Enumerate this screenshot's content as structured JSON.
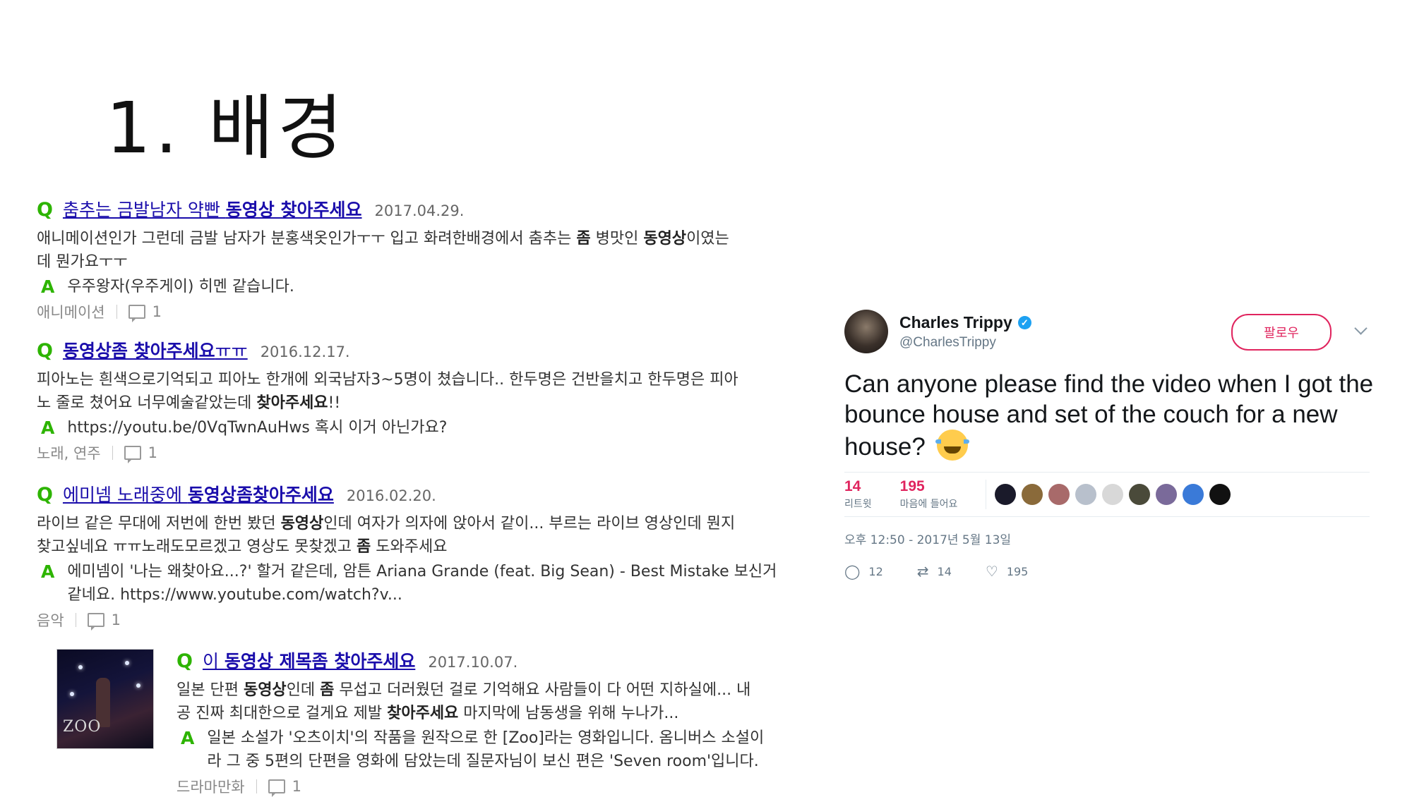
{
  "slide": {
    "title": "1. 배경"
  },
  "qa": [
    {
      "title_plain": "춤추는 금발남자 약빤 ",
      "title_bold": "동영상 찾아주세요",
      "date": "2017.04.29.",
      "body_parts": [
        "애니메이션인가 그런데 금발 남자가 분홍색옷인가ㅜㅜ 입고 화려한배경에서 춤추는 ",
        "좀",
        " 병맛인 ",
        "동영상",
        "이였는",
        "데 뭔가요ㅜㅜ"
      ],
      "answer": "우주왕자(우주게이) 히멘 같습니다.",
      "category": "애니메이션",
      "comments": "1"
    },
    {
      "title_bold": "동영상좀 찾아주세요",
      "title_plain": "ㅠㅠ",
      "date": "2016.12.17.",
      "body_line1": "피아노는 흰색으로기억되고 피아노 한개에 외국남자3~5명이 쳤습니다.. 한두명은 건반을치고 한두명은 피아",
      "body_line2_plain": "노 줄로 쳤어요 너무예술같았는데 ",
      "body_line2_bold": "찾아주세요",
      "body_line2_end": "!!",
      "answer": "https://youtu.be/0VqTwnAuHws 혹시 이거 아닌가요?",
      "category": "노래, 연주",
      "comments": "1"
    },
    {
      "title_plain": "에미넴 노래중에 ",
      "title_bold": "동영상좀찾아주세요",
      "date": "2016.02.20.",
      "body_line1_plain": "라이브 같은 무대에 저번에 한번 봤던 ",
      "body_line1_bold": "동영상",
      "body_line1_end": "인데 여자가 의자에 앉아서 같이... 부르는 라이브 영상인데 뭔지",
      "body_line2_plain": "찾고싶네요 ㅠㅠ노래도모르겠고 영상도 못찾겠고 ",
      "body_line2_bold": "좀",
      "body_line2_end": " 도와주세요",
      "answer_line1": "에미넴이 '나는 왜찾아요...?' 할거 같은데, 암튼 Ariana Grande (feat. Big Sean) - Best Mistake 보신거",
      "answer_line2": "같네요. https://www.youtube.com/watch?v...",
      "category": "음악",
      "comments": "1"
    },
    {
      "title_plain": "이 ",
      "title_bold": "동영상 제목좀 찾아주세요",
      "date": "2017.10.07.",
      "thumb_text": "ZOO",
      "body_line1_plain": "일본 단편 ",
      "body_line1_bold": "동영상",
      "body_line1_mid": "인데 ",
      "body_line1_bold2": "좀",
      "body_line1_end": " 무섭고 더러웠던 걸로 기억해요 사람들이 다 어떤 지하실에... 내",
      "body_line2_plain": "공 진짜 최대한으로 걸게요 제발 ",
      "body_line2_bold": "찾아주세요",
      "body_line2_end": " 마지막에 남동생을 위해 누나가...",
      "answer_line1": "일본 소설가 '오츠이치'의 작품을 원작으로 한 [Zoo]라는 영화입니다. 옴니버스 소설이",
      "answer_line2": "라 그 중 5편의 단편을 영화에 담았는데 질문자님이 보신 편은 'Seven room'입니다.",
      "category": "드라마만화",
      "comments": "1"
    }
  ],
  "icons": {
    "question": "Q",
    "answer": "A"
  },
  "tweet": {
    "name": "Charles Trippy",
    "handle": "@CharlesTrippy",
    "follow_label": "팔로우",
    "text": "Can anyone please find the video when I got the bounce house and set of the couch for a new house?",
    "retweets_num": "14",
    "retweets_label": "리트윗",
    "likes_num": "195",
    "likes_label": "마음에 들어요",
    "time": "오후 12:50 - 2017년 5월 13일",
    "reply_count": "12",
    "retweet_count": "14",
    "like_count": "195",
    "accent_color": "#e0245e"
  }
}
